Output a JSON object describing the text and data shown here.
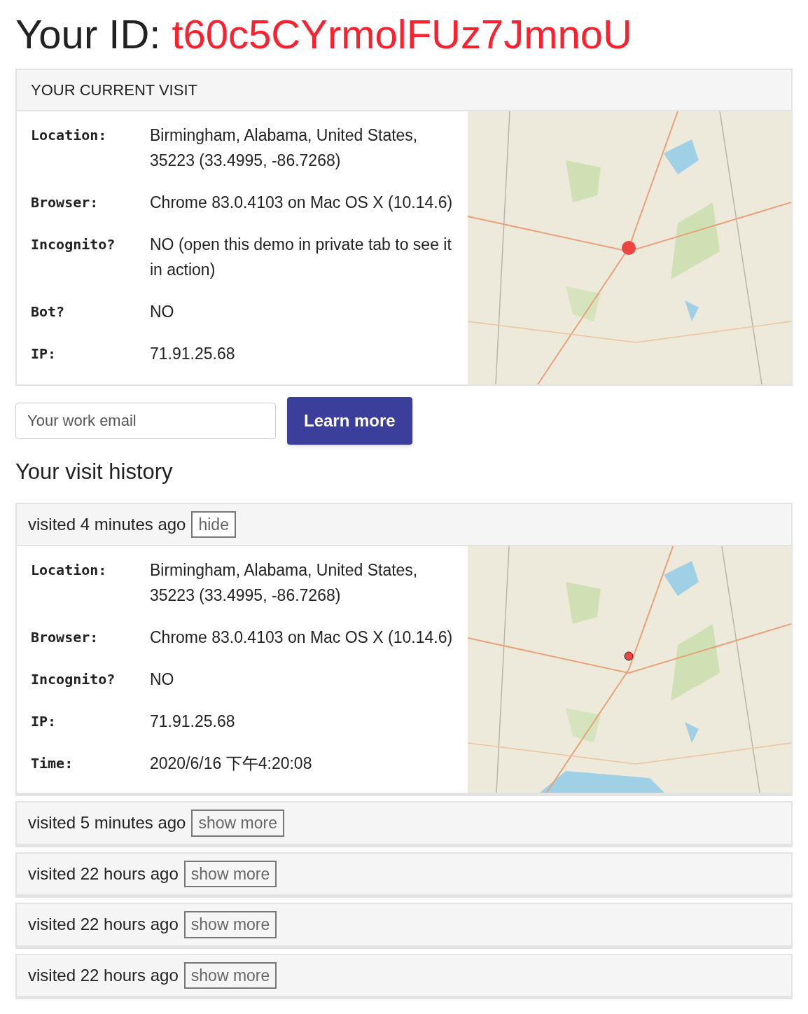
{
  "id_label": "Your ID:",
  "id_value": "t60c5CYrmolFUz7JmnoU",
  "current_visit": {
    "title": "YOUR CURRENT VISIT",
    "fields": [
      {
        "label": "Location:",
        "value": "Birmingham, Alabama, United States, 35223 (33.4995, -86.7268)"
      },
      {
        "label": "Browser:",
        "value": "Chrome 83.0.4103 on Mac OS X (10.14.6)"
      },
      {
        "label": "Incognito?",
        "value": "NO (open this demo in private tab to see it in action)"
      },
      {
        "label": "Bot?",
        "value": "NO"
      },
      {
        "label": "IP:",
        "value": "71.91.25.68"
      }
    ]
  },
  "signup": {
    "placeholder": "Your work email",
    "button": "Learn more"
  },
  "history_title": "Your visit history",
  "history": [
    {
      "title": "visited 4 minutes ago",
      "toggle": "hide",
      "expanded": true,
      "fields": [
        {
          "label": "Location:",
          "value": "Birmingham, Alabama, United States, 35223 (33.4995, -86.7268)"
        },
        {
          "label": "Browser:",
          "value": "Chrome 83.0.4103 on Mac OS X (10.14.6)"
        },
        {
          "label": "Incognito?",
          "value": "NO"
        },
        {
          "label": "IP:",
          "value": "71.91.25.68"
        },
        {
          "label": "Time:",
          "value": "2020/6/16 下午4:20:08"
        }
      ]
    },
    {
      "title": "visited 5 minutes ago",
      "toggle": "show more",
      "expanded": false
    },
    {
      "title": "visited 22 hours ago",
      "toggle": "show more",
      "expanded": false
    },
    {
      "title": "visited 22 hours ago",
      "toggle": "show more",
      "expanded": false
    },
    {
      "title": "visited 22 hours ago",
      "toggle": "show more",
      "expanded": false
    }
  ]
}
